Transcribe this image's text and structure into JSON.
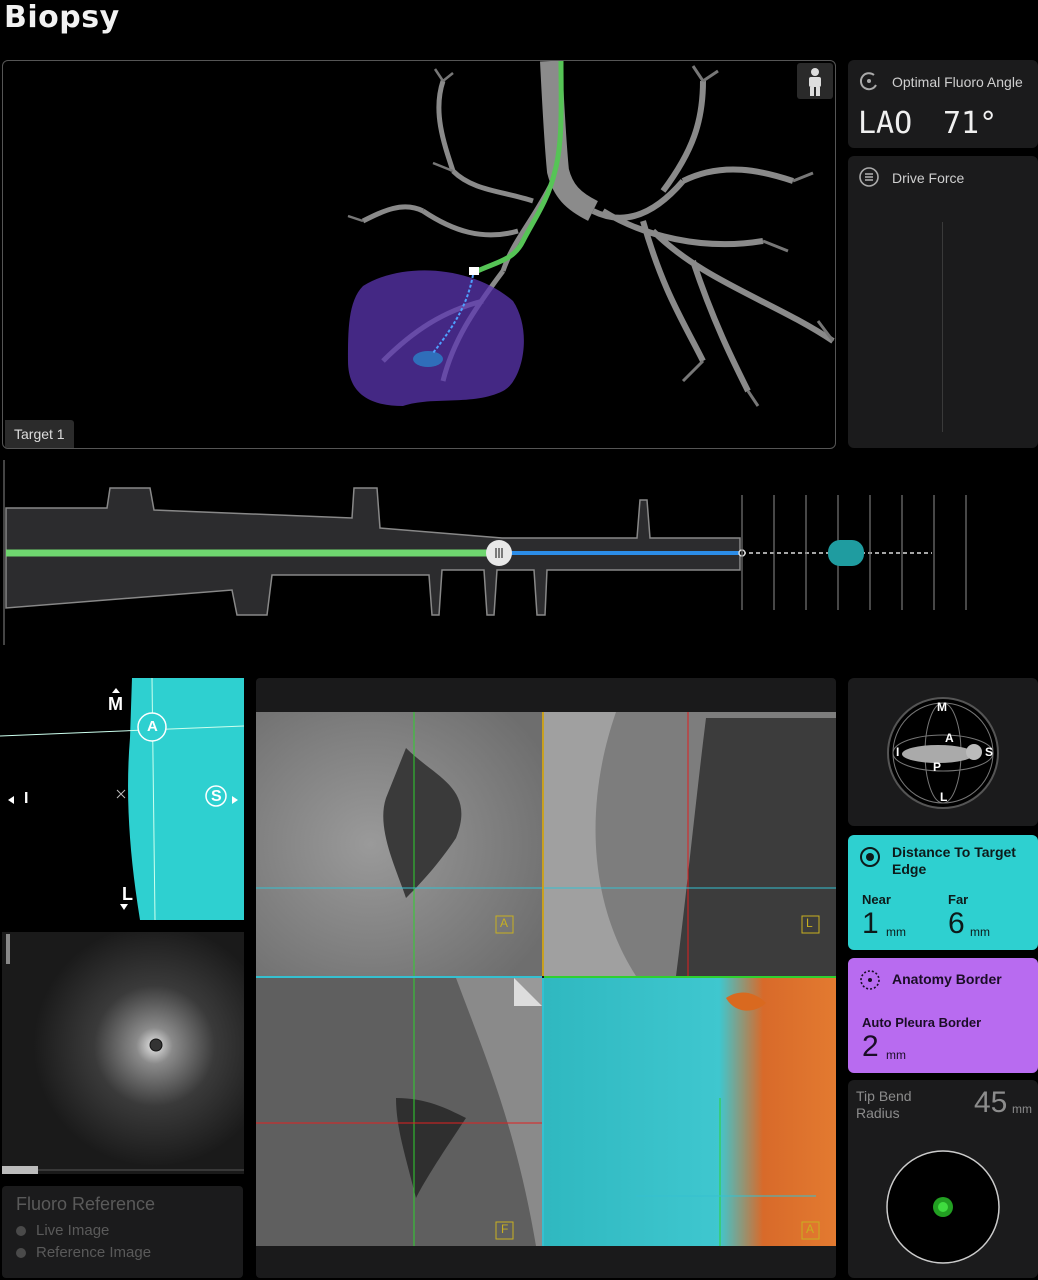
{
  "page": {
    "title": "Biopsy"
  },
  "navigation_view": {
    "target_label": "Target 1"
  },
  "fluoro_angle": {
    "title": "Optimal Fluoro Angle",
    "direction": "LAO",
    "value": "71°"
  },
  "drive_force": {
    "title": "Drive Force"
  },
  "axial_view": {
    "labels": {
      "M": "M",
      "L": "L",
      "I": "I",
      "S": "S",
      "A": "A"
    }
  },
  "orientation_widget": {
    "labels": {
      "M": "M",
      "L": "L",
      "S": "S",
      "P": "P",
      "A": "A",
      "I": "I"
    }
  },
  "distance_to_target": {
    "title": "Distance To Target Edge",
    "near_label": "Near",
    "near_value": "1",
    "far_label": "Far",
    "far_value": "6",
    "unit": "mm"
  },
  "anatomy_border": {
    "title": "Anatomy Border",
    "sub_label": "Auto Pleura Border",
    "value": "2",
    "unit": "mm"
  },
  "tip_bend": {
    "label": "Tip Bend Radius",
    "value": "45",
    "unit": "mm"
  },
  "ct_views": {
    "labels": {
      "top_left": "A",
      "top_right": "L",
      "bottom_left": "F",
      "bottom_right": "A"
    }
  },
  "fluoro_reference": {
    "title": "Fluoro Reference",
    "options": [
      "Live Image",
      "Reference Image"
    ]
  },
  "colors": {
    "accent_cyan": "#2ed0d0",
    "accent_purple": "#b86bf0",
    "path_green": "#6fd66f",
    "path_blue": "#2c8de8"
  }
}
